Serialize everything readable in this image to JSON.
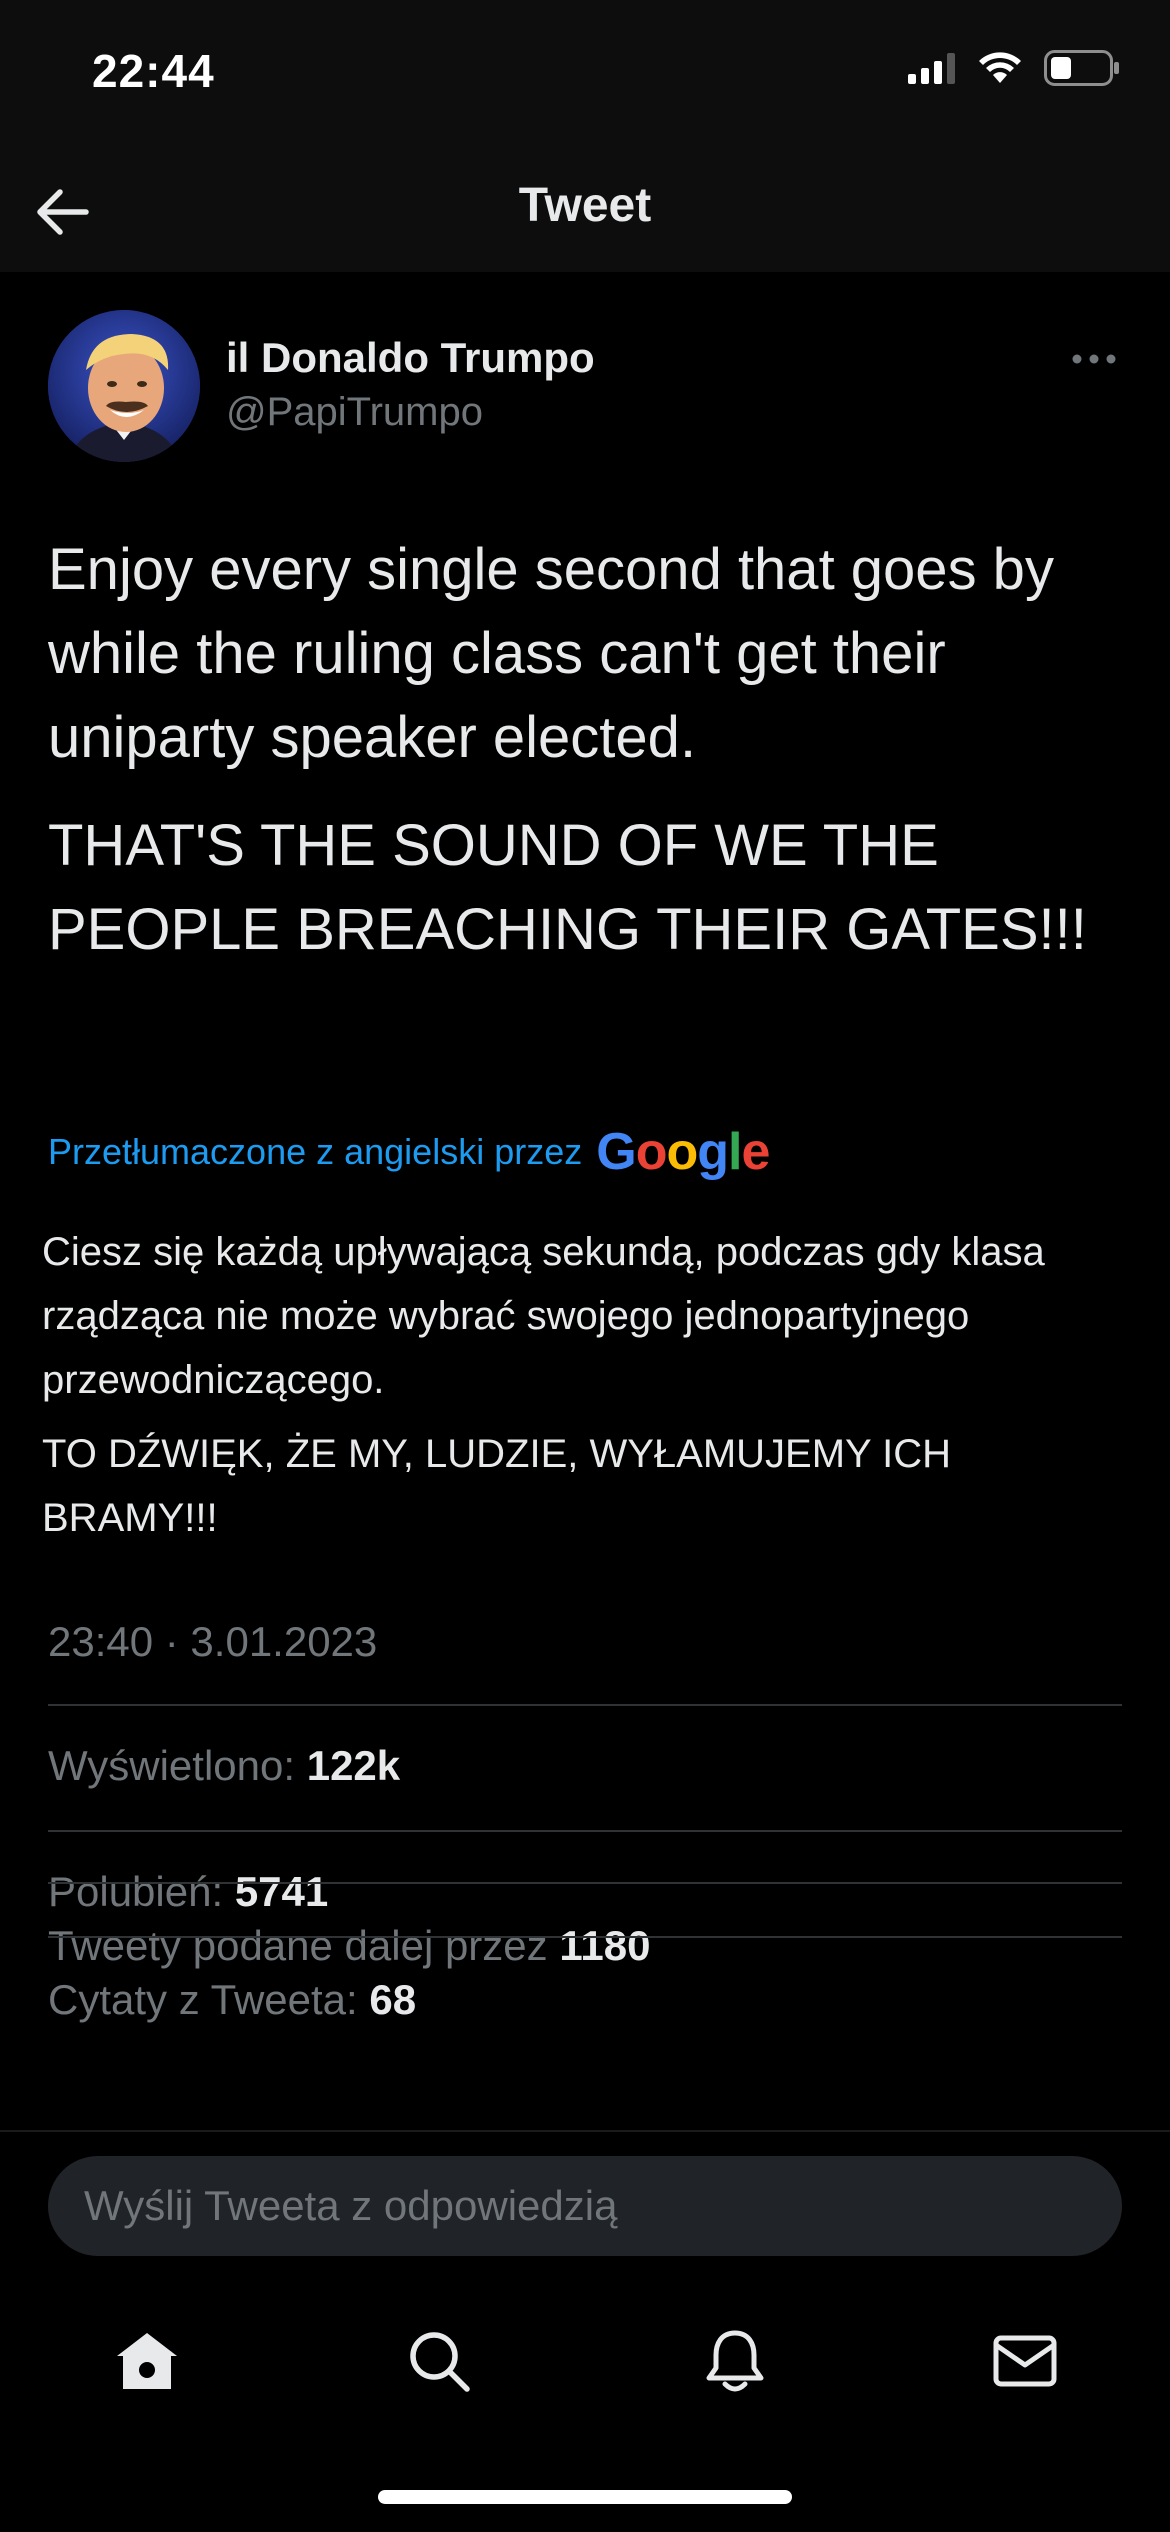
{
  "status_bar": {
    "time": "22:44",
    "icons": [
      "cellular-signal-icon",
      "wifi-icon",
      "battery-icon"
    ]
  },
  "nav": {
    "title": "Tweet",
    "back_icon": "arrow-left-icon"
  },
  "author": {
    "display_name": "il Donaldo Trumpo",
    "handle": "@PapiTrumpo",
    "more_icon": "more-horizontal-icon"
  },
  "tweet": {
    "paragraphs": [
      "Enjoy every single second that goes by while the ruling class can't get their uniparty speaker elected.",
      "THAT'S THE SOUND OF WE THE PEOPLE BREACHING THEIR GATES!!!"
    ]
  },
  "translation": {
    "label": "Przetłumaczone z angielski przez",
    "provider": "Google",
    "paragraphs": [
      "Ciesz się każdą upływającą sekundą, podczas gdy klasa rządząca nie może wybrać swojego jednopartyjnego przewodniczącego.",
      "TO DŹWIĘK, ŻE MY, LUDZIE, WYŁAMUJEMY ICH BRAMY!!!"
    ]
  },
  "meta": {
    "timestamp": "23:40 · 3.01.2023"
  },
  "stats": {
    "views_label": "Wyświetlono:",
    "views_value": "122k",
    "likes_label": "Polubień:",
    "likes_value": "5741",
    "retweets_label": "Tweety podane dalej przez",
    "retweets_value": "1180",
    "quotes_label": "Cytaty z Tweeta:",
    "quotes_value": "68"
  },
  "reply": {
    "placeholder": "Wyślij Tweeta z odpowiedzią"
  },
  "tabs": [
    {
      "name": "home",
      "icon": "home-icon",
      "active": true
    },
    {
      "name": "search",
      "icon": "search-icon",
      "active": false
    },
    {
      "name": "notifications",
      "icon": "bell-icon",
      "active": false
    },
    {
      "name": "messages",
      "icon": "mail-icon",
      "active": false
    }
  ],
  "colors": {
    "background": "#000000",
    "text": "#e7e9ea",
    "muted": "#71767b",
    "link": "#1d9bf0",
    "divider": "#2f3336"
  }
}
